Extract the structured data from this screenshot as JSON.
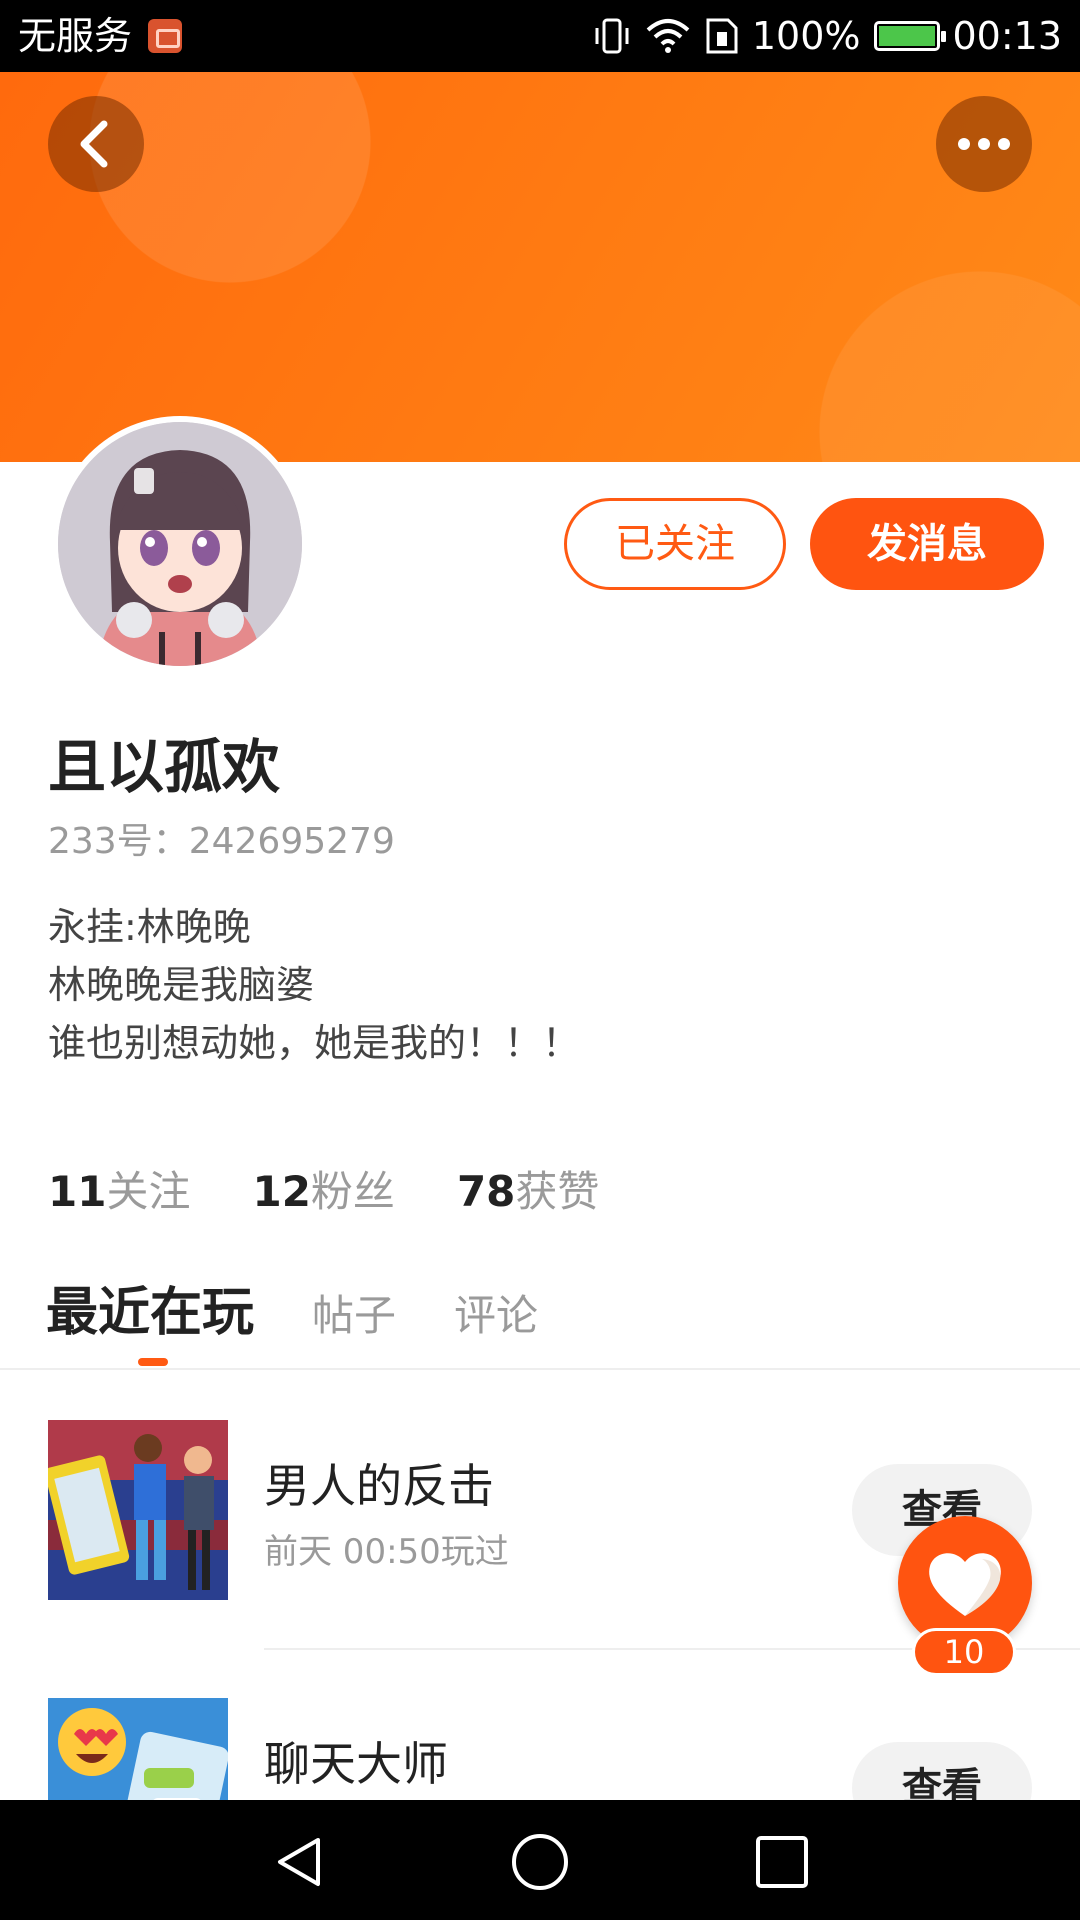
{
  "status_bar": {
    "carrier": "无服务",
    "battery_percent": "100%",
    "time": "00:13",
    "icons": [
      "notification-app-icon",
      "vibrate-icon",
      "wifi-icon",
      "sim-icon",
      "battery-charging-icon"
    ]
  },
  "header": {
    "back_icon": "chevron-left-icon",
    "more_icon": "more-dots-icon",
    "accent_color": "#ff5a13"
  },
  "profile": {
    "follow_status_label": "已关注",
    "message_label": "发消息",
    "nickname": "且以孤欢",
    "uid": "233号：242695279",
    "bio": [
      "永挂:林晚晚",
      "林晚晚是我脑婆",
      "谁也别想动她，她是我的！！！"
    ],
    "stats": [
      {
        "num": "11",
        "label": "关注"
      },
      {
        "num": "12",
        "label": "粉丝"
      },
      {
        "num": "78",
        "label": "获赞"
      }
    ]
  },
  "tabs": [
    {
      "label": "最近在玩",
      "active": true
    },
    {
      "label": "帖子",
      "active": false
    },
    {
      "label": "评论",
      "active": false
    }
  ],
  "games": [
    {
      "title": "男人的反击",
      "subtitle": "前天 00:50玩过",
      "button": "查看"
    },
    {
      "title": "聊天大师",
      "subtitle": "",
      "button": "查看"
    }
  ],
  "like_fab": {
    "icon": "heart-icon",
    "count": "10"
  },
  "nav_bar": {
    "icons": [
      "nav-back-icon",
      "nav-home-icon",
      "nav-recents-icon"
    ]
  }
}
